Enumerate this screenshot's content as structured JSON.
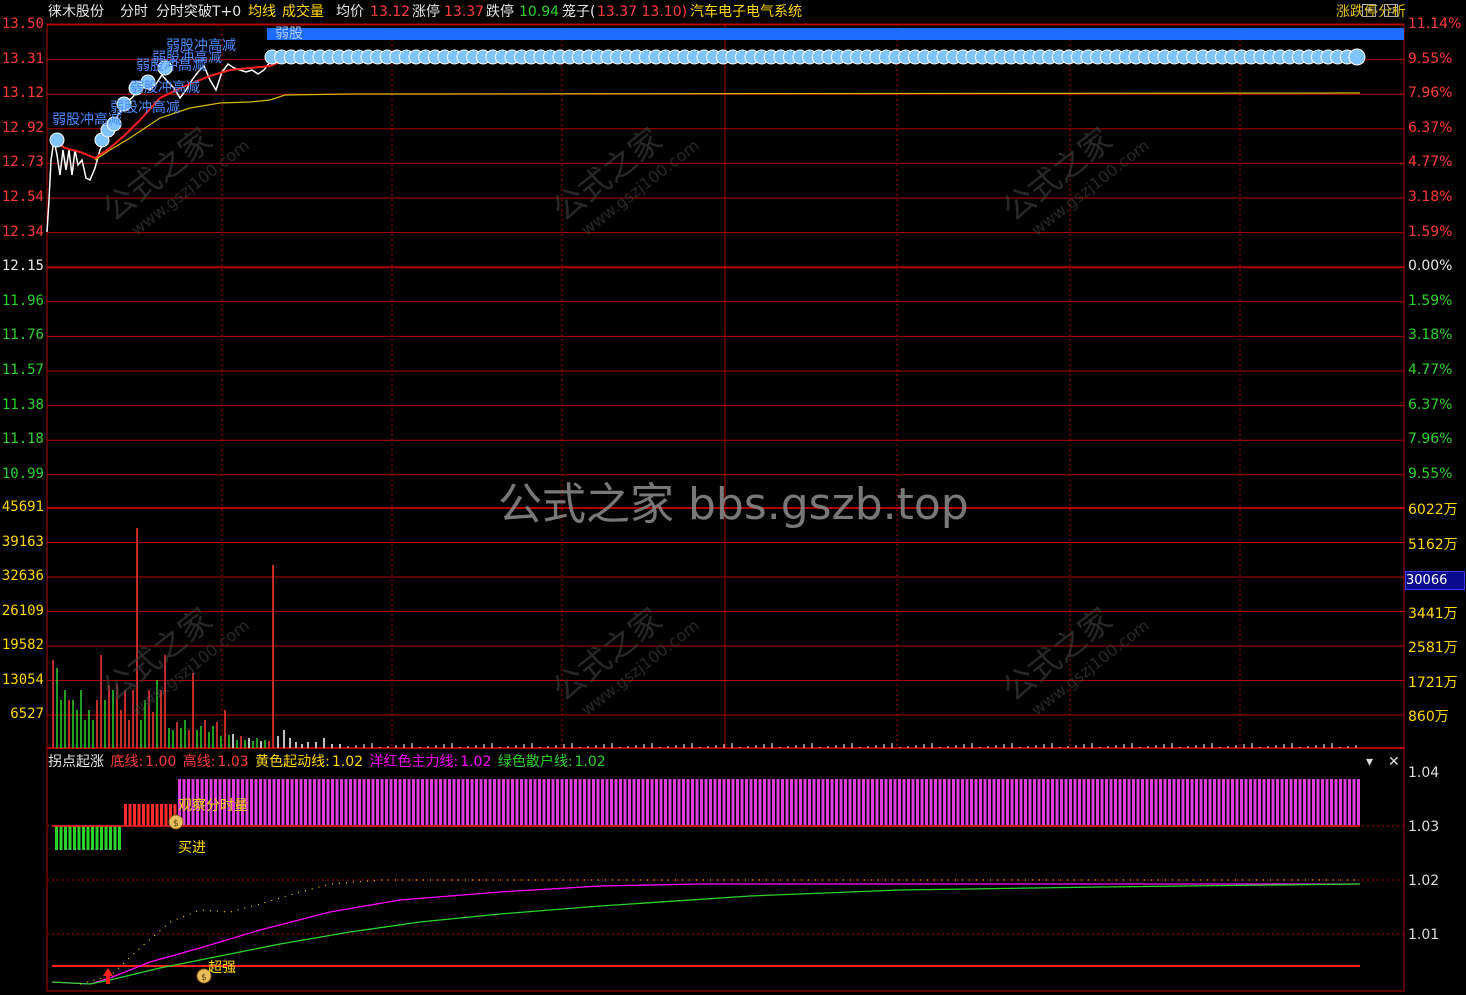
{
  "header": {
    "stock_name": "徕木股份",
    "mode": "分时",
    "indicator": "分时突破T+0",
    "avg_line_label": "均线",
    "volume_label": "成交量",
    "avg_price_label": "均价",
    "avg_price": "13.12",
    "limit_up_label": "涨停",
    "limit_up": "13.37",
    "limit_down_label": "跌停",
    "limit_down": "10.94",
    "cage_label": "笼子(",
    "cage_values": "13.37 13.10)",
    "sector": "汽车电子电气系统",
    "analysis": "涨跌停分析"
  },
  "price_axis_left": [
    "13.50",
    "13.31",
    "13.12",
    "12.92",
    "12.73",
    "12.54",
    "12.34",
    "12.15",
    "11.96",
    "11.76",
    "11.57",
    "11.38",
    "11.18",
    "10.99"
  ],
  "price_axis_right": [
    "11.14%",
    "9.55%",
    "7.96%",
    "6.37%",
    "4.77%",
    "3.18%",
    "1.59%",
    "0.00%",
    "1.59%",
    "3.18%",
    "4.77%",
    "6.37%",
    "7.96%",
    "9.55%"
  ],
  "volume_axis_left": [
    "45691",
    "39163",
    "32636",
    "26109",
    "19582",
    "13054",
    "6527"
  ],
  "volume_axis_right": [
    "6022万",
    "5162万",
    "4301万",
    "3441万",
    "2581万",
    "1721万",
    "860万"
  ],
  "volume_highlight": "30066",
  "annotations": {
    "weak_stock": "弱股冲高减",
    "weak_stock_blue": "弱股",
    "observe": "观察分时量",
    "buy": "买进",
    "strong": "超强"
  },
  "sub_indicator": {
    "name": "拐点起涨",
    "bottom_label": "底线:",
    "bottom_value": "1.00",
    "high_label": "高线:",
    "high_value": "1.03",
    "yellow_label": "黄色起动线:",
    "yellow_value": "1.02",
    "magenta_label": "洋红色主力线:",
    "magenta_value": "1.02",
    "green_label": "绿色散户线:",
    "green_value": "1.02",
    "axis": [
      "1.04",
      "1.03",
      "1.02",
      "1.01"
    ],
    "menu_icon": "dropdown-arrow",
    "close_icon": "close"
  },
  "watermark": {
    "main": "公式之家 bbs.gszb.top",
    "diag_cn": "公式之家",
    "diag_url": "www.gszj100.com"
  },
  "colors": {
    "up": "#ff3b3b",
    "down": "#2bd22b",
    "grid": "#b00000",
    "price": "#ffffff",
    "avg": "#ffd700",
    "magenta": "#ff00ff",
    "highlight_bar": "#1e6bff"
  }
}
